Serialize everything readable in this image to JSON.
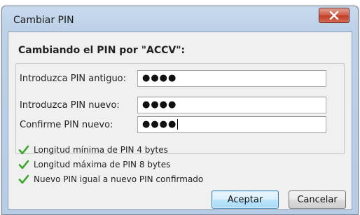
{
  "dialog": {
    "title": "Cambiar PIN",
    "heading": "Cambiando el PIN por \"ACCV\":",
    "fields": [
      {
        "label": "Introduzca PIN antiguo:",
        "value": "●●●●"
      },
      {
        "label": "Introduzca PIN nuevo:",
        "value": "●●●●"
      },
      {
        "label": "Confirme PIN nuevo:",
        "value": "●●●●"
      }
    ],
    "checks": [
      {
        "text": "Longitud mínima de PIN 4 bytes",
        "icon": "check-icon"
      },
      {
        "text": "Longitud máxima de PIN 8 bytes",
        "icon": "check-icon"
      },
      {
        "text": "Nuevo PIN igual a nuevo PIN confirmado",
        "icon": "check-icon"
      }
    ],
    "buttons": {
      "accept": "Aceptar",
      "cancel": "Cancelar",
      "close": "close-icon"
    }
  },
  "colors": {
    "check": "#3aa62a",
    "close_button": "#c9452f",
    "primary_button_border": "#3c7fb1"
  }
}
